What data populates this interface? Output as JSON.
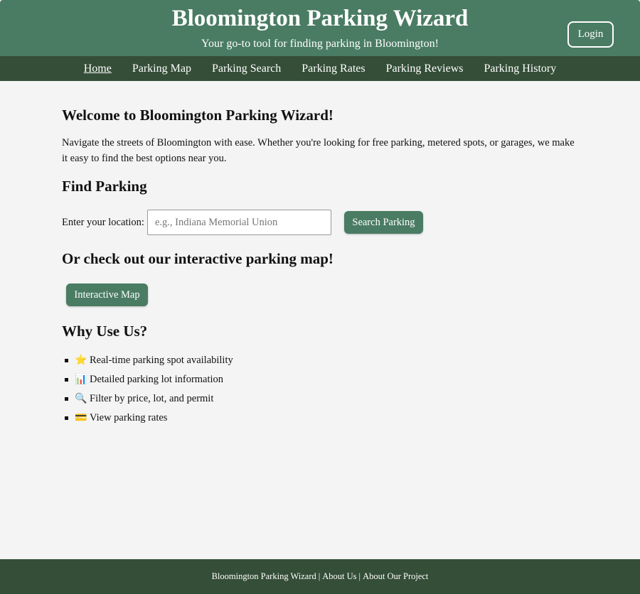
{
  "header": {
    "title": "Bloomington Parking Wizard",
    "tagline": "Your go-to tool for finding parking in Bloomington!",
    "login_label": "Login"
  },
  "nav": {
    "items": [
      {
        "label": "Home"
      },
      {
        "label": "Parking Map"
      },
      {
        "label": "Parking Search"
      },
      {
        "label": "Parking Rates"
      },
      {
        "label": "Parking Reviews"
      },
      {
        "label": "Parking History"
      }
    ]
  },
  "main": {
    "welcome_title": "Welcome to Bloomington Parking Wizard!",
    "intro": "Navigate the streets of Bloomington with ease. Whether you're looking for free parking, metered spots, or garages, we make it easy to find the best options near you.",
    "find_title": "Find Parking",
    "search_label": "Enter your location:",
    "search_placeholder": "e.g., Indiana Memorial Union",
    "search_button": "Search Parking",
    "map_title": "Or check out our interactive parking map!",
    "map_button": "Interactive Map",
    "why_title": "Why Use Us?",
    "features": [
      {
        "icon": "star-icon",
        "emoji": "⭐",
        "label": "Real-time parking spot availability"
      },
      {
        "icon": "bar-chart-icon",
        "emoji": "📊",
        "label": "Detailed parking lot information"
      },
      {
        "icon": "magnifier-icon",
        "emoji": "🔍",
        "label": "Filter by price, lot, and permit"
      },
      {
        "icon": "credit-card-icon",
        "emoji": "💳",
        "label": "View parking rates"
      }
    ]
  },
  "footer": {
    "brand": "Bloomington Parking Wizard",
    "separator": "|",
    "about_us": "About Us",
    "about_project": "About Our Project"
  },
  "colors": {
    "header_bg": "#4a7c63",
    "nav_bg": "#344e37",
    "button_bg": "#4a7c63",
    "page_bg": "#f4f4f4"
  }
}
